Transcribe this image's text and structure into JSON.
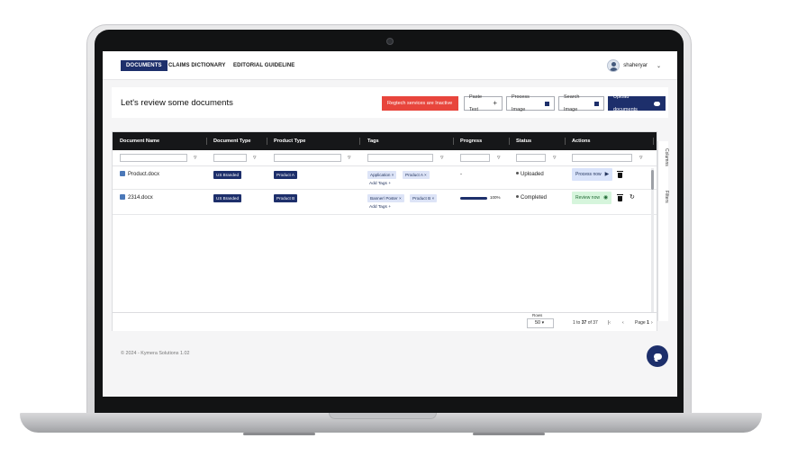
{
  "nav": {
    "tabs": [
      "DOCUMENTS",
      "CLAIMS DICTIONARY",
      "EDITORIAL GUIDELINE"
    ],
    "active_tab": "DOCUMENTS",
    "user_name": "shaheryar"
  },
  "header": {
    "title": "Let's review some documents",
    "regtech_status": "Regtech services are Inactive",
    "paste_text": "Paste Text",
    "process_image": "Process Image",
    "search_image": "Search Image",
    "upload_documents": "Upload documents"
  },
  "table": {
    "columns": [
      "Document Name",
      "Document Type",
      "Product Type",
      "Tags",
      "Progress",
      "Status",
      "Actions"
    ],
    "rows": [
      {
        "name": "Product.docx",
        "doc_type": "US Branded",
        "product_type": "Product A",
        "tags": [
          "Application",
          "Product A"
        ],
        "add_tags": "Add Tags",
        "progress_text": "-",
        "status": "Uploaded",
        "action": "Process now"
      },
      {
        "name": "2314.docx",
        "doc_type": "US Branded",
        "product_type": "Product B",
        "tags": [
          "Banner/ Poster",
          "Product B"
        ],
        "add_tags": "Add Tags",
        "progress_text": "100%",
        "progress_value": 1.0,
        "status": "Completed",
        "action": "Review now"
      }
    ],
    "side_panel": [
      "Columns",
      "Filters"
    ]
  },
  "pagination": {
    "rows_label": "Rows",
    "rows_value": "50",
    "range_text_1": "1",
    "range_text_to": "to",
    "range_text_2": "37",
    "range_text_of": "of 37",
    "page_label": "Page",
    "page_value": "1"
  },
  "footer": {
    "copyright": "© 2024 - Kymera Solutions 1.02"
  },
  "colors": {
    "brand_navy": "#1d2f6b",
    "alert_red": "#e8453c",
    "header_black": "#161719"
  }
}
